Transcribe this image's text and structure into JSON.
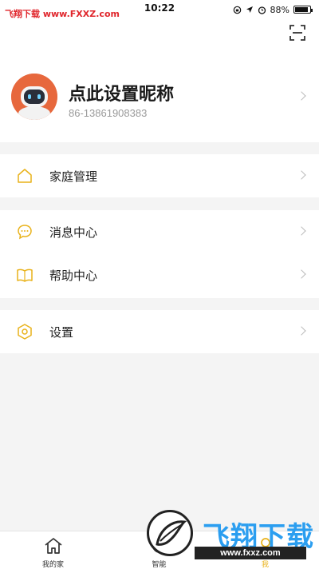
{
  "status_bar": {
    "watermark": "飞翔下载 www.FXXZ.com",
    "time": "10:22",
    "battery": "88%",
    "battery_level": 0.88
  },
  "profile": {
    "nickname": "点此设置昵称",
    "phone": "86-13861908383"
  },
  "menu": {
    "family": "家庭管理",
    "messages": "消息中心",
    "help": "帮助中心",
    "settings": "设置"
  },
  "tabbar": {
    "tabs": [
      {
        "label": "我的家",
        "icon": "home-icon"
      },
      {
        "label": "智能",
        "icon": "smart-icon"
      },
      {
        "label": "我",
        "icon": "me-icon",
        "active": true
      }
    ]
  },
  "watermark": {
    "title": "飞翔下载",
    "url": "www.fxxz.com"
  },
  "colors": {
    "accent": "#e9b21a",
    "avatar": "#e7683d",
    "watermark_blue": "#2b9ef0"
  }
}
